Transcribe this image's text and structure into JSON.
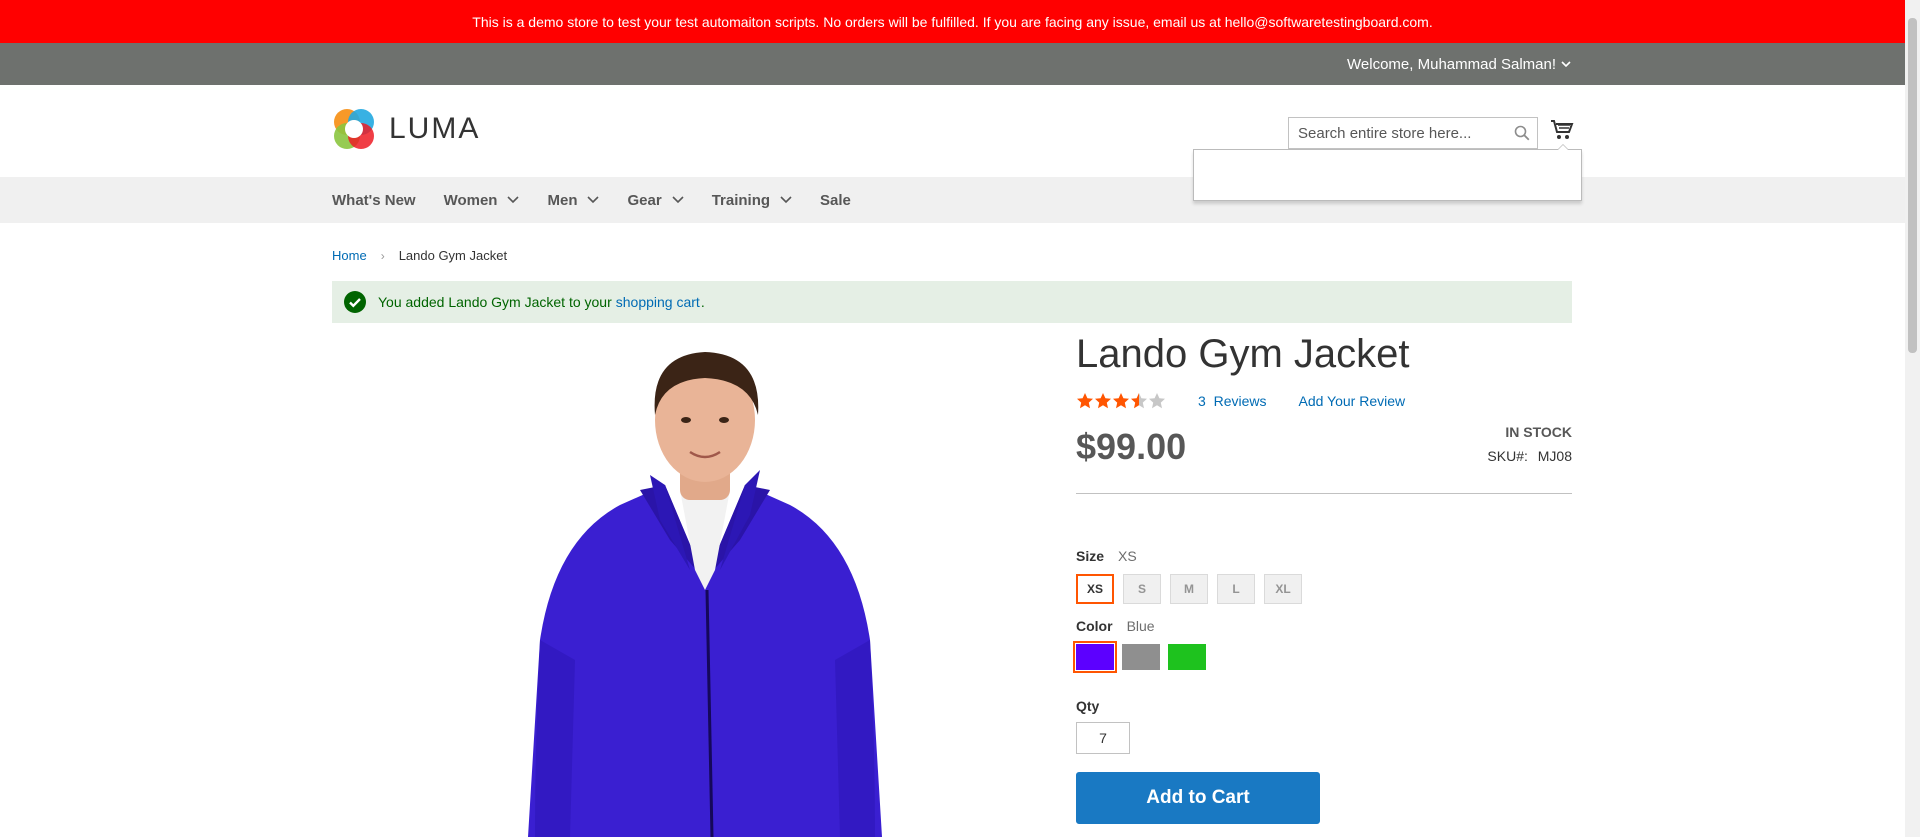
{
  "demo_banner": {
    "text": "This is a demo store to test your test automaiton scripts. No orders will be fulfilled. If you are facing any issue, email us at hello@softwaretestingboard.com."
  },
  "topbar": {
    "welcome": "Welcome, Muhammad Salman!"
  },
  "header": {
    "logo_text": "LUMA",
    "search_placeholder": "Search entire store here..."
  },
  "nav": {
    "items": [
      {
        "label": "What's New",
        "has_dropdown": false
      },
      {
        "label": "Women",
        "has_dropdown": true
      },
      {
        "label": "Men",
        "has_dropdown": true
      },
      {
        "label": "Gear",
        "has_dropdown": true
      },
      {
        "label": "Training",
        "has_dropdown": true
      },
      {
        "label": "Sale",
        "has_dropdown": false
      }
    ]
  },
  "breadcrumb": {
    "home": "Home",
    "current": "Lando Gym Jacket"
  },
  "message": {
    "prefix": "You added Lando Gym Jacket to your",
    "link": "shopping cart",
    "suffix": "."
  },
  "product": {
    "title": "Lando Gym Jacket",
    "rating_percent": 60,
    "reviews_count": "3",
    "reviews_label": "Reviews",
    "add_review": "Add Your Review",
    "price": "$99.00",
    "stock": "In stock",
    "sku_label": "SKU#:",
    "sku": "MJ08",
    "size": {
      "label": "Size",
      "selected": "XS",
      "options": [
        "XS",
        "S",
        "M",
        "L",
        "XL"
      ]
    },
    "color": {
      "label": "Color",
      "selected": "Blue",
      "options": [
        {
          "name": "Blue",
          "hex": "#5c00ff"
        },
        {
          "name": "Gray",
          "hex": "#8f8f8f"
        },
        {
          "name": "Green",
          "hex": "#1ec21e"
        }
      ]
    },
    "qty_label": "Qty",
    "qty_value": "7",
    "add_to_cart": "Add to Cart"
  },
  "colors": {
    "banner": "#ff0000",
    "topbar": "#6e716e",
    "link": "#006bb4",
    "button": "#1979c3",
    "star": "#ff5501",
    "success_bg": "#e5efe5"
  }
}
